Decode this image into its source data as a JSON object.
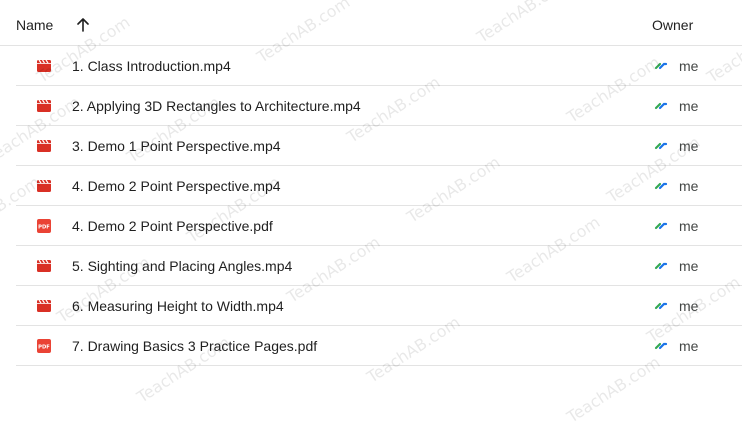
{
  "header": {
    "name_label": "Name",
    "sort_icon": "arrow-up-icon",
    "owner_label": "Owner"
  },
  "files": [
    {
      "name": "1. Class Introduction.mp4",
      "type": "video",
      "owner": "me"
    },
    {
      "name": "2. Applying 3D Rectangles to Architecture.mp4",
      "type": "video",
      "owner": "me"
    },
    {
      "name": "3. Demo 1 Point Perspective.mp4",
      "type": "video",
      "owner": "me"
    },
    {
      "name": "4. Demo 2 Point Perspective.mp4",
      "type": "video",
      "owner": "me"
    },
    {
      "name": "4. Demo 2 Point Perspective.pdf",
      "type": "pdf",
      "owner": "me"
    },
    {
      "name": "5. Sighting and Placing Angles.mp4",
      "type": "video",
      "owner": "me"
    },
    {
      "name": "6. Measuring Height to Width.mp4",
      "type": "video",
      "owner": "me"
    },
    {
      "name": "7. Drawing Basics 3 Practice Pages.pdf",
      "type": "pdf",
      "owner": "me"
    }
  ],
  "colors": {
    "video_icon": "#d93025",
    "pdf_icon": "#ea4335",
    "shared_icon_green": "#34a853",
    "shared_icon_blue": "#1a73e8"
  },
  "watermark": "TeachAB.com",
  "pdf_badge": "PDF"
}
